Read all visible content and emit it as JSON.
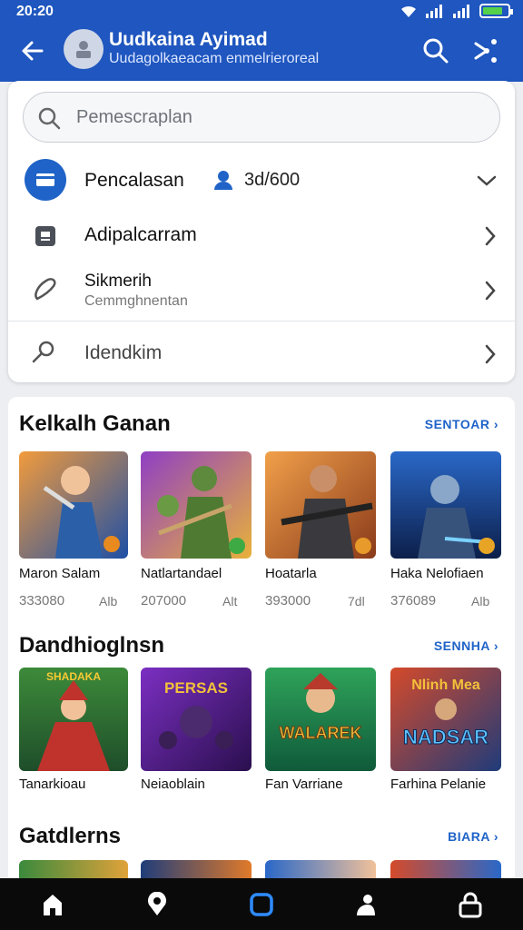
{
  "status": {
    "time": "20:20"
  },
  "appbar": {
    "title": "Uudkaina Ayimad",
    "subtitle": "Uudagolkaeacam enmelrieroreal"
  },
  "menu": {
    "search_placeholder": "Pemescraplan",
    "rows": [
      {
        "label": "Pencalasan",
        "badge_text": "3d/600"
      },
      {
        "label": "Adipalcarram"
      },
      {
        "label": "Sikmerih",
        "sub": "Cemmghnentan"
      },
      {
        "label": "Idendkim"
      }
    ]
  },
  "sections": [
    {
      "title": "Kelkalh Ganan",
      "link": "SENTOAR",
      "games": [
        {
          "name": "Maron Salam",
          "count": "333080",
          "badge": "Alb"
        },
        {
          "name": "Natlartandael",
          "count": "207000",
          "badge": "Alt"
        },
        {
          "name": "Hoatarla",
          "count": "393000",
          "badge": "7dl"
        },
        {
          "name": "Haka Nelofiaen",
          "count": "376089",
          "badge": "Alb"
        }
      ]
    },
    {
      "title": "Dandhioglnsn",
      "link": "SENNHA",
      "games": [
        {
          "name": "Tanarkioau",
          "art_text": "SHADAKA"
        },
        {
          "name": "Neiaoblain",
          "art_text": "PERSAS"
        },
        {
          "name": "Fan Varriane",
          "art_text": "WALAREK"
        },
        {
          "name": "Farhina Pelanie",
          "art_text": "NADSAR",
          "art_text2": "Nlinh Mea"
        }
      ]
    },
    {
      "title": "Gatdlerns",
      "link": "BIARA"
    }
  ],
  "colors": {
    "accent": "#1f56bf",
    "link": "#1f63c8",
    "nav_bg": "#0a0a0a"
  },
  "bottom_nav": [
    "home-icon",
    "location-icon",
    "square-icon",
    "person-icon",
    "lock-icon"
  ]
}
